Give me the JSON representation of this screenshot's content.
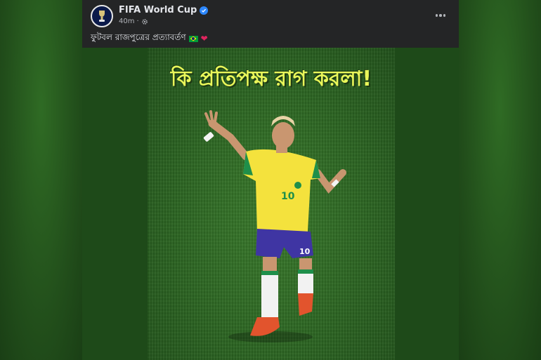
{
  "post": {
    "page_name": "FIFA World Cup",
    "timestamp": "40m",
    "caption_text": "ফুটবল রাজপুত্রের প্রত্যাবর্তণ",
    "caption_emojis": [
      "brazil-flag",
      "red-heart"
    ]
  },
  "image": {
    "overlay_text": "কি প্রতিপক্ষ রাগ করলা!",
    "jersey_number": "10"
  },
  "colors": {
    "card_bg": "#242526",
    "text_primary": "#e4e6eb",
    "text_secondary": "#b0b3b8",
    "verified_blue": "#2d88ff",
    "overlay_yellow": "#e9f75a",
    "pitch_green": "#2c6522"
  }
}
